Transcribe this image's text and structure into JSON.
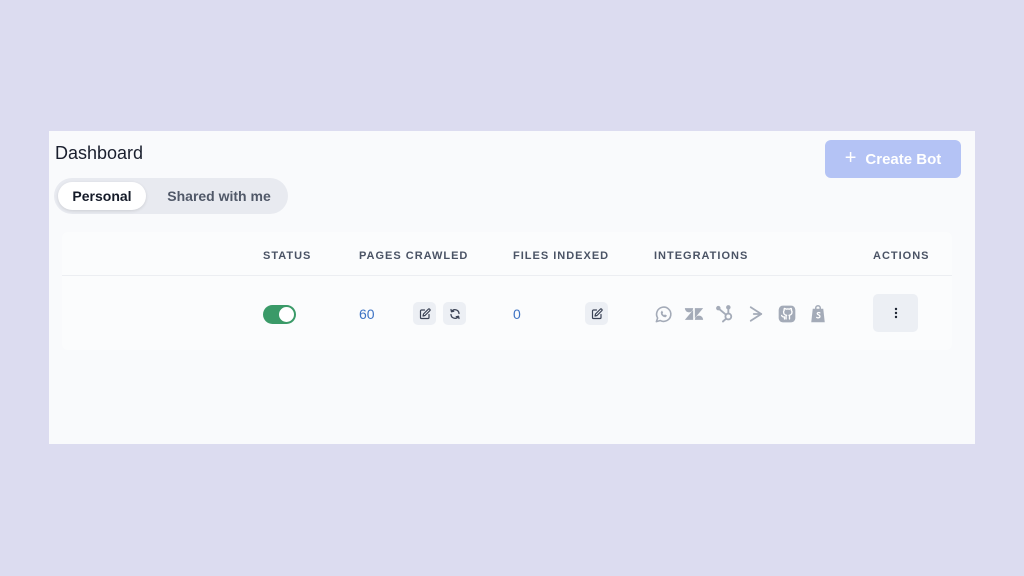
{
  "header": {
    "title": "Dashboard",
    "create_button": {
      "icon": "plus-icon",
      "label": "Create Bot"
    }
  },
  "tabs": [
    {
      "label": "Personal",
      "active": true
    },
    {
      "label": "Shared with me",
      "active": false
    }
  ],
  "table": {
    "columns": [
      "STATUS",
      "PAGES CRAWLED",
      "FILES INDEXED",
      "INTEGRATIONS",
      "ACTIONS"
    ],
    "rows": [
      {
        "status_enabled": true,
        "pages_crawled": "60",
        "files_indexed": "0",
        "integrations": [
          "whatsapp-icon",
          "zendesk-icon",
          "hubspot-icon",
          "intercom-icon",
          "github-icon",
          "shopify-icon"
        ]
      }
    ]
  },
  "colors": {
    "page_background": "#dcdcf0",
    "panel_background": "#f9fafc",
    "create_button": "#b4c3f5",
    "toggle_on": "#3a9a68",
    "link": "#3e73c4",
    "icon_gray": "#a4abb8"
  }
}
